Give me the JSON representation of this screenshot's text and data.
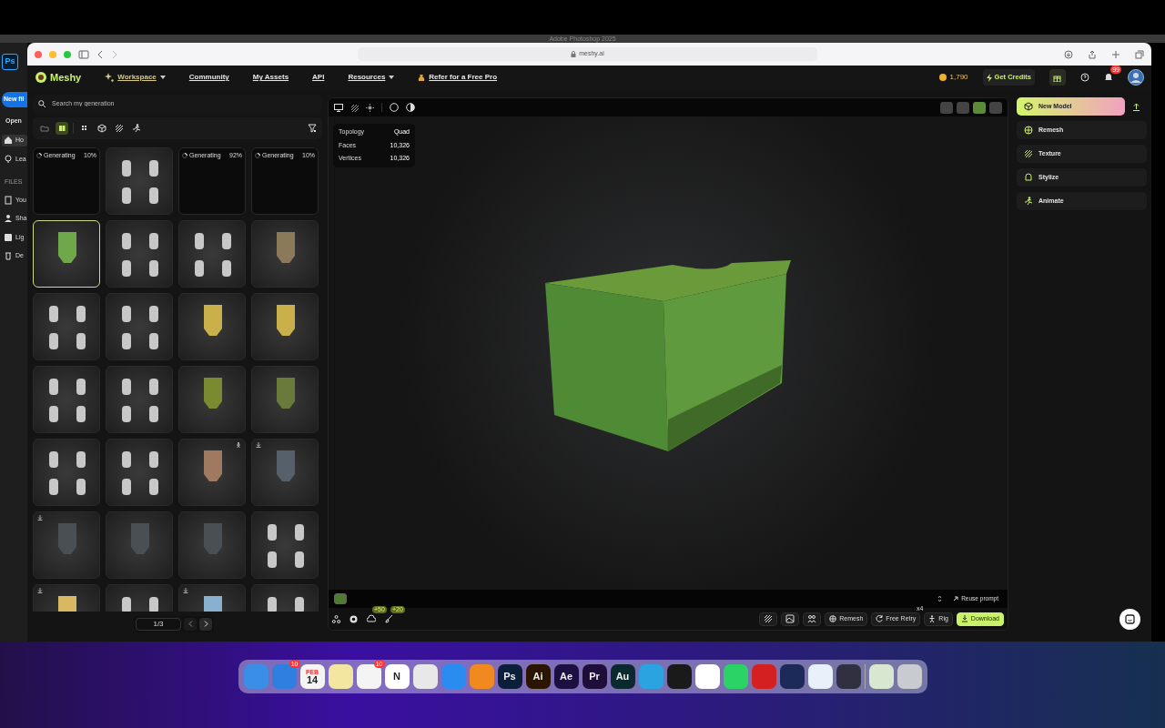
{
  "mac_title": "Adobe Photoshop 2025",
  "photoshop_sidebar": {
    "app_icon": "Ps",
    "new_button": "New fil",
    "open_button": "Open",
    "nav": [
      {
        "label": "Ho",
        "selected": true
      },
      {
        "label": "Lea",
        "selected": false
      }
    ],
    "section": "FILES",
    "files": [
      "You",
      "Sha",
      "Lig",
      "De"
    ]
  },
  "browser": {
    "url": "meshy.ai"
  },
  "navbar": {
    "logo": "Meshy",
    "items": [
      {
        "label": "Workspace",
        "dropdown": true,
        "selected": true
      },
      {
        "label": "Community",
        "dropdown": false,
        "selected": false
      },
      {
        "label": "My Assets",
        "dropdown": false,
        "selected": false
      },
      {
        "label": "API",
        "dropdown": false,
        "selected": false
      },
      {
        "label": "Resources",
        "dropdown": true,
        "selected": false
      },
      {
        "label": "Refer for a Free Pro",
        "dropdown": false,
        "selected": false
      }
    ],
    "credits": "1,790",
    "get_credits": "Get Credits",
    "notification_badge": "99"
  },
  "library": {
    "search": {
      "placeholder": "Search my generation"
    },
    "filters": [
      {
        "selected": false
      },
      {
        "selected": true
      },
      {
        "selected": false
      },
      {
        "selected": false
      },
      {
        "selected": false
      },
      {
        "selected": false
      }
    ],
    "tiles": [
      {
        "kind": "generating",
        "status": "Generating",
        "percent": "10%",
        "selected": false
      },
      {
        "kind": "quad",
        "selected": false
      },
      {
        "kind": "generating",
        "status": "Generating",
        "percent": "92%",
        "selected": false
      },
      {
        "kind": "generating",
        "status": "Generating",
        "percent": "10%",
        "selected": false
      },
      {
        "kind": "single",
        "color": "#6fa84a",
        "selected": true
      },
      {
        "kind": "quad",
        "selected": false
      },
      {
        "kind": "quad",
        "selected": false
      },
      {
        "kind": "single",
        "color": "#8a7a5a",
        "selected": false
      },
      {
        "kind": "quad",
        "selected": false
      },
      {
        "kind": "quad",
        "selected": false
      },
      {
        "kind": "single",
        "color": "#c9b04a",
        "selected": false
      },
      {
        "kind": "single",
        "color": "#c9b04a",
        "selected": false
      },
      {
        "kind": "quad",
        "selected": false
      },
      {
        "kind": "quad",
        "selected": false
      },
      {
        "kind": "single",
        "color": "#7a8a30",
        "selected": false
      },
      {
        "kind": "single",
        "color": "#6a7a3a",
        "selected": false
      },
      {
        "kind": "quad",
        "selected": false
      },
      {
        "kind": "quad",
        "selected": false
      },
      {
        "kind": "single",
        "color": "#a07a60",
        "rigged": true,
        "selected": false
      },
      {
        "kind": "single",
        "color": "#55606a",
        "downloaded": true,
        "selected": false
      },
      {
        "kind": "single",
        "color": "#4a4f55",
        "downloaded": true,
        "selected": false
      },
      {
        "kind": "single",
        "color": "#4a4f55",
        "selected": false
      },
      {
        "kind": "single",
        "color": "#4a4f55",
        "selected": false
      },
      {
        "kind": "quad",
        "selected": false
      },
      {
        "kind": "single",
        "color": "#d8b860",
        "downloaded": true,
        "selected": false
      },
      {
        "kind": "quad",
        "selected": false
      },
      {
        "kind": "single",
        "color": "#8ab0d0",
        "downloaded": true,
        "selected": false
      },
      {
        "kind": "quad",
        "selected": false
      }
    ],
    "pagination": "1/3"
  },
  "viewport": {
    "view_modes": [
      {
        "selected": false
      },
      {
        "selected": false
      },
      {
        "selected": true
      },
      {
        "selected": false
      }
    ],
    "stats": [
      {
        "label": "Topology",
        "value": "Quad"
      },
      {
        "label": "Faces",
        "value": "10,326"
      },
      {
        "label": "Vertices",
        "value": "10,326"
      }
    ],
    "reuse_prompt": "Reuse prompt",
    "badges": [
      "+50",
      "+20"
    ],
    "actions": [
      {
        "label": "Remesh",
        "kind": "plain"
      },
      {
        "label": "Free Retry",
        "kind": "plain",
        "count": "x4"
      },
      {
        "label": "Rig",
        "kind": "plain"
      },
      {
        "label": "Download",
        "kind": "primary"
      }
    ]
  },
  "tools": [
    {
      "label": "New Model",
      "selected": true
    },
    {
      "label": "Remesh",
      "selected": false
    },
    {
      "label": "Texture",
      "selected": false
    },
    {
      "label": "Stylize",
      "selected": false
    },
    {
      "label": "Animate",
      "selected": false
    }
  ],
  "dock": [
    {
      "color": "#3a8ee6"
    },
    {
      "color": "#2f7fe0",
      "badge": "10"
    },
    {
      "color": "#f4f4f4",
      "glyph": "14",
      "caption": "FEB"
    },
    {
      "color": "#f3e6a0"
    },
    {
      "color": "#f4f4f4",
      "badge": "10"
    },
    {
      "color": "#ffffff",
      "glyph": "N"
    },
    {
      "color": "#e8e8e8"
    },
    {
      "color": "#2a8cf0"
    },
    {
      "color": "#f08a20"
    },
    {
      "color": "#0b1e3a",
      "glyph": "Ps"
    },
    {
      "color": "#2b1500",
      "glyph": "Ai"
    },
    {
      "color": "#1b1040",
      "glyph": "Ae"
    },
    {
      "color": "#1f0e3a",
      "glyph": "Pr"
    },
    {
      "color": "#0b2a2f",
      "glyph": "Au"
    },
    {
      "color": "#2aa3e0"
    },
    {
      "color": "#1a1a1a"
    },
    {
      "color": "#ffffff"
    },
    {
      "color": "#2bd366"
    },
    {
      "color": "#d42020"
    },
    {
      "color": "#1c2a5a"
    },
    {
      "color": "#e8f0fa"
    },
    {
      "color": "#303040"
    },
    {
      "color": "#d8e8d0"
    },
    {
      "color": "#c8ccd0"
    }
  ]
}
